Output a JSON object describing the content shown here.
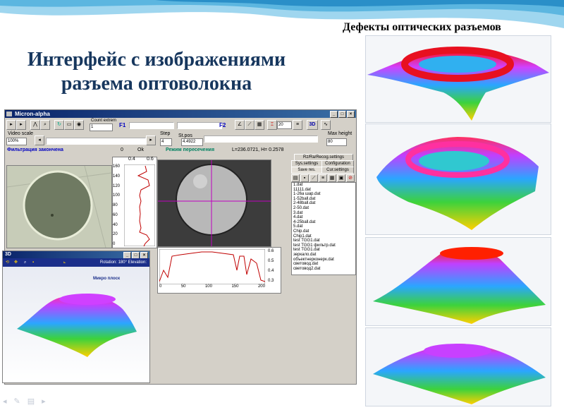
{
  "slide": {
    "title_line1": "Интерфейс с изображениями",
    "title_line2": "разъема оптоволокна",
    "right_caption": "Дефекты оптических разъемов"
  },
  "app": {
    "window_title": "Micron-alpha",
    "toolbar": {
      "count_label": "Count extrem",
      "count_value": "1",
      "f1": "F1",
      "f2": "F2",
      "x_field": "20",
      "btn_3d": "3D"
    },
    "row2": {
      "video_scale_label": "Video scale",
      "video_scale_value": "100%",
      "step_label": "Step",
      "step_value": "4",
      "stpos_label": "St.pos",
      "stpos_value": "4.4922",
      "max_height_label": "Max height",
      "max_height_value": "80"
    },
    "status": {
      "left": "Фильтрация закончена",
      "mid_a": "0",
      "mid_b": "Ok",
      "mode": "Режим пересечения",
      "coords": "L=236.0721, H= 0.2578"
    },
    "vgraph": {
      "top_ticks": [
        "0.4",
        "0.6"
      ],
      "y_ticks": [
        "160",
        "140",
        "120",
        "100",
        "80",
        "60",
        "40",
        "20",
        "0"
      ]
    },
    "hgraph": {
      "x_ticks": [
        "0",
        "50",
        "100",
        "150",
        "200"
      ],
      "y_ticks": [
        "0.6",
        "0.5",
        "0.4",
        "0.3"
      ]
    },
    "tabs": {
      "row1": [
        "Rz/Ra/Recog.settings"
      ],
      "row2": [
        "Sys.settings",
        "Configuration"
      ],
      "row3": [
        "Save res.",
        "Cur.settings"
      ]
    },
    "files": [
      "1.dat",
      "11111.dat",
      "1-26а шар.dat",
      "1-52ball.dat",
      "2-48ball.dat",
      "2-50.dat",
      "3.dat",
      "4.dat",
      "4-25ball.dat",
      "5.dat",
      "Chip.dat",
      "Chip1.dat",
      "test TGG1.dat",
      "test TGG1 фильтр.dat",
      "test TGG1.dat",
      "зеркало.dat",
      "объектнерконерк.dat",
      "световод.dat",
      "световод2.dat"
    ]
  },
  "win3d": {
    "title": "3D",
    "rotation": "Rotation: 180° Elevation:",
    "label": "Микро плоск"
  },
  "colors": {
    "title_color": "#17375e",
    "window_titlebar": "#0a246a",
    "panel_bg": "#d4d0c8",
    "crosshair": "#c000c0",
    "graph_line": "#c00000"
  }
}
